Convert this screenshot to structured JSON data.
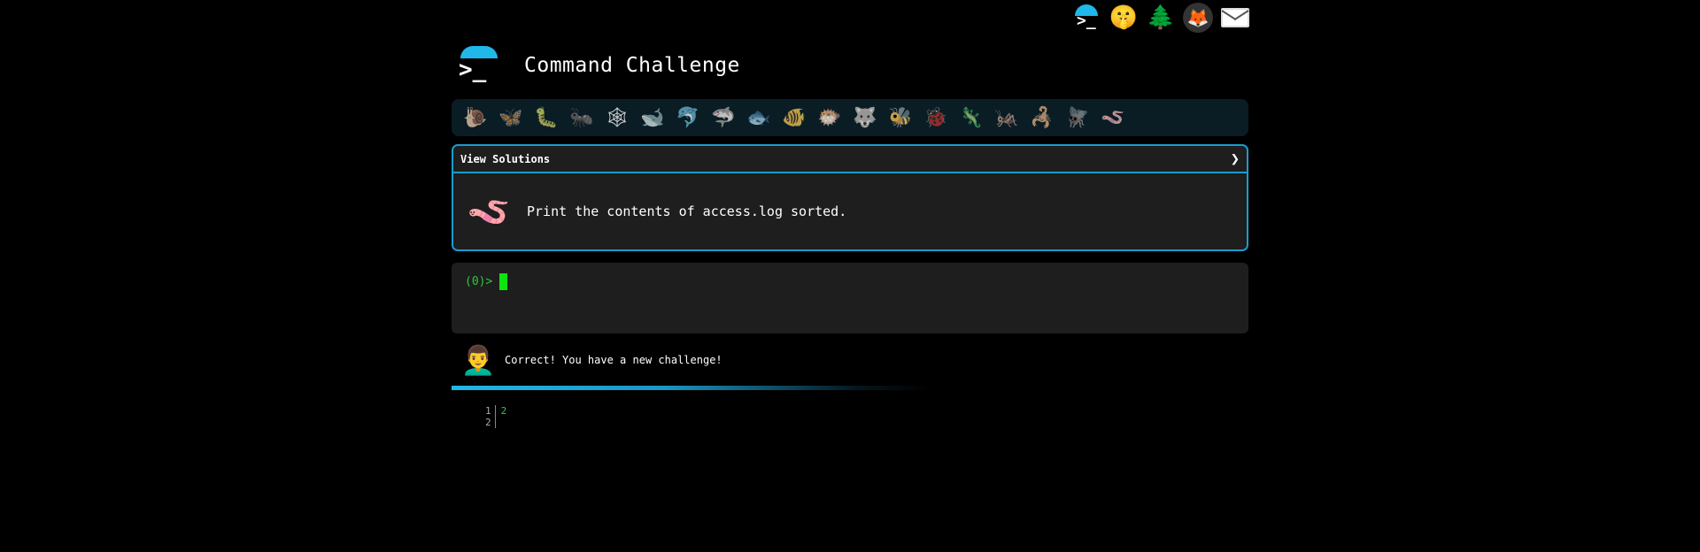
{
  "header": {
    "title": "Command Challenge",
    "logo_glyph": ">_"
  },
  "top_icons": [
    {
      "name": "command-challenge-icon",
      "glyph": ">_"
    },
    {
      "name": "shushing-face-icon",
      "glyph": "🤫"
    },
    {
      "name": "evergreen-tree-icon",
      "glyph": "🌲"
    },
    {
      "name": "gitlab-icon",
      "glyph": "🦊"
    },
    {
      "name": "envelope-icon",
      "glyph": ""
    }
  ],
  "creatures": [
    {
      "name": "snail-icon",
      "glyph": "🐌"
    },
    {
      "name": "butterfly-icon",
      "glyph": "🦋"
    },
    {
      "name": "caterpillar-icon",
      "glyph": "🐛"
    },
    {
      "name": "ant-icon",
      "glyph": "🐜"
    },
    {
      "name": "spider-web-icon",
      "glyph": "🕸"
    },
    {
      "name": "whale-icon",
      "glyph": "🐋"
    },
    {
      "name": "dolphin-icon",
      "glyph": "🐬"
    },
    {
      "name": "shark-icon",
      "glyph": "🦈"
    },
    {
      "name": "fish-icon",
      "glyph": "🐟"
    },
    {
      "name": "tropical-fish-icon",
      "glyph": "🐠"
    },
    {
      "name": "blowfish-icon",
      "glyph": "🐡"
    },
    {
      "name": "wolf-icon",
      "glyph": "🐺"
    },
    {
      "name": "bee-icon",
      "glyph": "🐝"
    },
    {
      "name": "ladybug-icon",
      "glyph": "🐞"
    },
    {
      "name": "lizard-icon",
      "glyph": "🦎"
    },
    {
      "name": "cricket-icon",
      "glyph": "🦗"
    },
    {
      "name": "scorpion-icon",
      "glyph": "🦂"
    },
    {
      "name": "fly-icon",
      "glyph": "🪰"
    },
    {
      "name": "worm-icon",
      "glyph": "🪱"
    }
  ],
  "challenge": {
    "view_solutions_label": "View Solutions",
    "toggle_glyph": "❯",
    "icon_glyph": "🪱",
    "description": "Print the contents of access.log sorted."
  },
  "terminal": {
    "prompt": "(0)>"
  },
  "feedback": {
    "avatar_glyph": "👨‍🦱",
    "message": "Correct! You have a new challenge!"
  },
  "output": {
    "line_numbers": "1\n2",
    "content": "2"
  },
  "colors": {
    "accent": "#1fb8e8",
    "prompt_green": "#2ccb3a",
    "cursor_green": "#0ee30e",
    "panel_bg": "#1e1e1e"
  }
}
